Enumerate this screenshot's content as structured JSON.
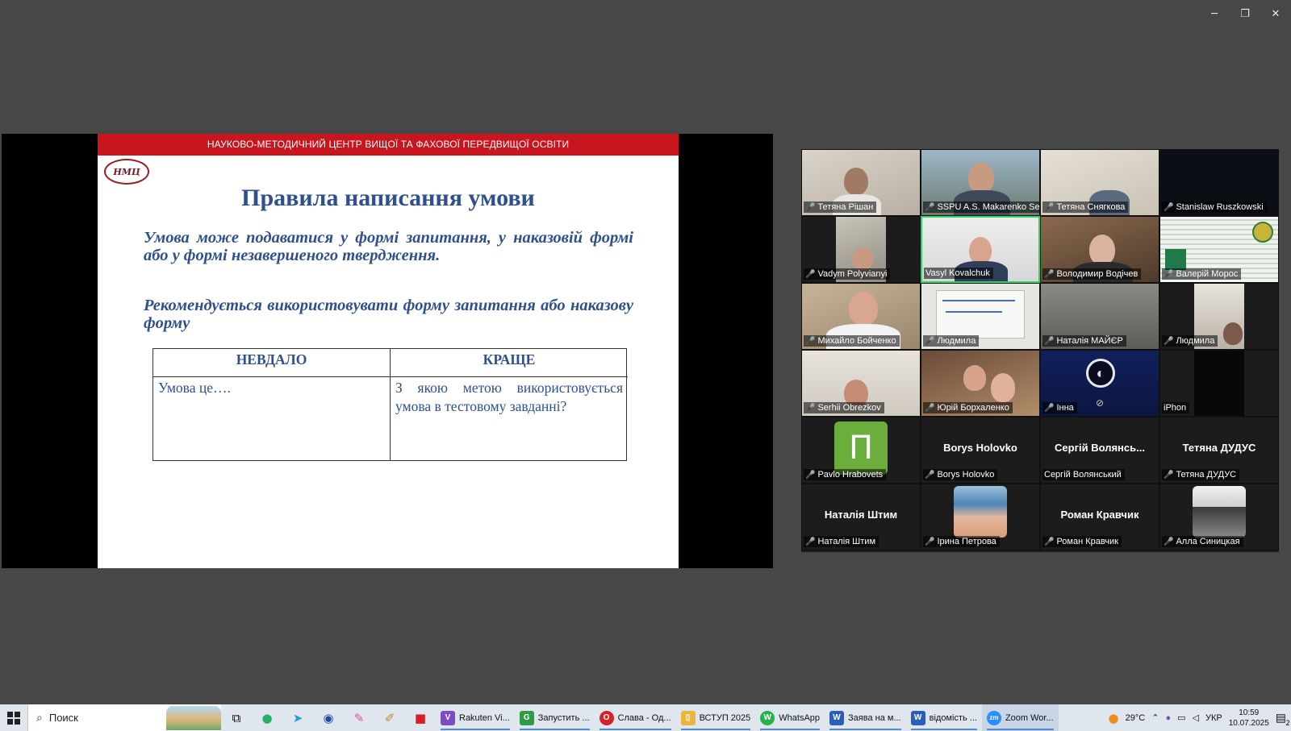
{
  "window": {
    "minimize_icon": "─",
    "restore_icon": "❐",
    "close_icon": "✕"
  },
  "slide": {
    "banner": "НАУКОВО-МЕТОДИЧНИЙ ЦЕНТР ВИЩОЇ ТА ФАХОВОЇ ПЕРЕДВИЩОЇ ОСВІТИ",
    "logo": "НМЦ",
    "title": "Правила написання умови",
    "para1": "Умова може подаватися у формі запитання, у наказовій формі або у формі незавершеного твердження.",
    "para2": "Рекомендується використовувати форму запитання або наказову форму",
    "table": {
      "headers": [
        "НЕВДАЛО",
        "КРАЩЕ"
      ],
      "row": [
        "Умова це….",
        "З якою метою використовується умова в тестовому завданні?"
      ]
    }
  },
  "participants": [
    {
      "name": "Тетяна Рішан",
      "muted": true
    },
    {
      "name": "SSPU A.S. Makarenko Se...",
      "muted": true
    },
    {
      "name": "Тетяна Снягкова",
      "muted": true
    },
    {
      "name": "Stanislaw Ruszkowski",
      "muted": true
    },
    {
      "name": "Vadym Polyvianyi",
      "muted": true
    },
    {
      "name": "Vasyl Kovalchuk",
      "muted": false
    },
    {
      "name": "Володимир Водічев",
      "muted": true
    },
    {
      "name": "Валерій Морос",
      "muted": true
    },
    {
      "name": "Михайло Бойченко",
      "muted": true
    },
    {
      "name": "Людмила",
      "muted": true
    },
    {
      "name": "Наталія МАЙЄР",
      "muted": true
    },
    {
      "name": "Людмила",
      "muted": true
    },
    {
      "name": "Serhii Obrezkov",
      "muted": true
    },
    {
      "name": "Юрій Борхаленко",
      "muted": true
    },
    {
      "name": "Інна",
      "muted": true
    },
    {
      "name": "iPhon",
      "muted": false
    },
    {
      "name": "Pavlo Hrabovets",
      "muted": true,
      "avatar": "П"
    },
    {
      "name": "Borys Holovko",
      "muted": true,
      "display": "Borys Holovko"
    },
    {
      "name": "Сергій Волянський",
      "muted": false,
      "display": "Сергій Волянсь..."
    },
    {
      "name": "Тетяна ДУДУС",
      "muted": true,
      "display": "Тетяна ДУДУС"
    },
    {
      "name": "Наталія Штим",
      "muted": true,
      "display": "Наталія Штим"
    },
    {
      "name": "Ірина Петрова",
      "muted": true
    },
    {
      "name": "Роман Кравчик",
      "muted": true,
      "display": "Роман Кравчик"
    },
    {
      "name": "Алла Синицкая",
      "muted": true
    }
  ],
  "taskbar": {
    "search_placeholder": "Поиск",
    "apps": [
      {
        "label": "Rakuten Vi...",
        "color": "#7d4cc4",
        "glyph": "V"
      },
      {
        "label": "Запустить ...",
        "color": "#2f9b47",
        "glyph": "G"
      },
      {
        "label": "Слава - Од...",
        "color": "#d6202a",
        "glyph": "O"
      },
      {
        "label": "ВСТУП 2025",
        "color": "#e9b53a",
        "glyph": "▯"
      },
      {
        "label": "WhatsApp",
        "color": "#27b14b",
        "glyph": "W"
      },
      {
        "label": "Заява на м...",
        "color": "#2b5eb8",
        "glyph": "W"
      },
      {
        "label": "відомість ...",
        "color": "#2b5eb8",
        "glyph": "W"
      },
      {
        "label": "Zoom Wor...",
        "color": "#2d8cff",
        "glyph": "zm"
      }
    ],
    "temperature": "29°C",
    "language": "УКР",
    "time": "10:59",
    "date": "10.07.2025",
    "notification_count": "2"
  }
}
